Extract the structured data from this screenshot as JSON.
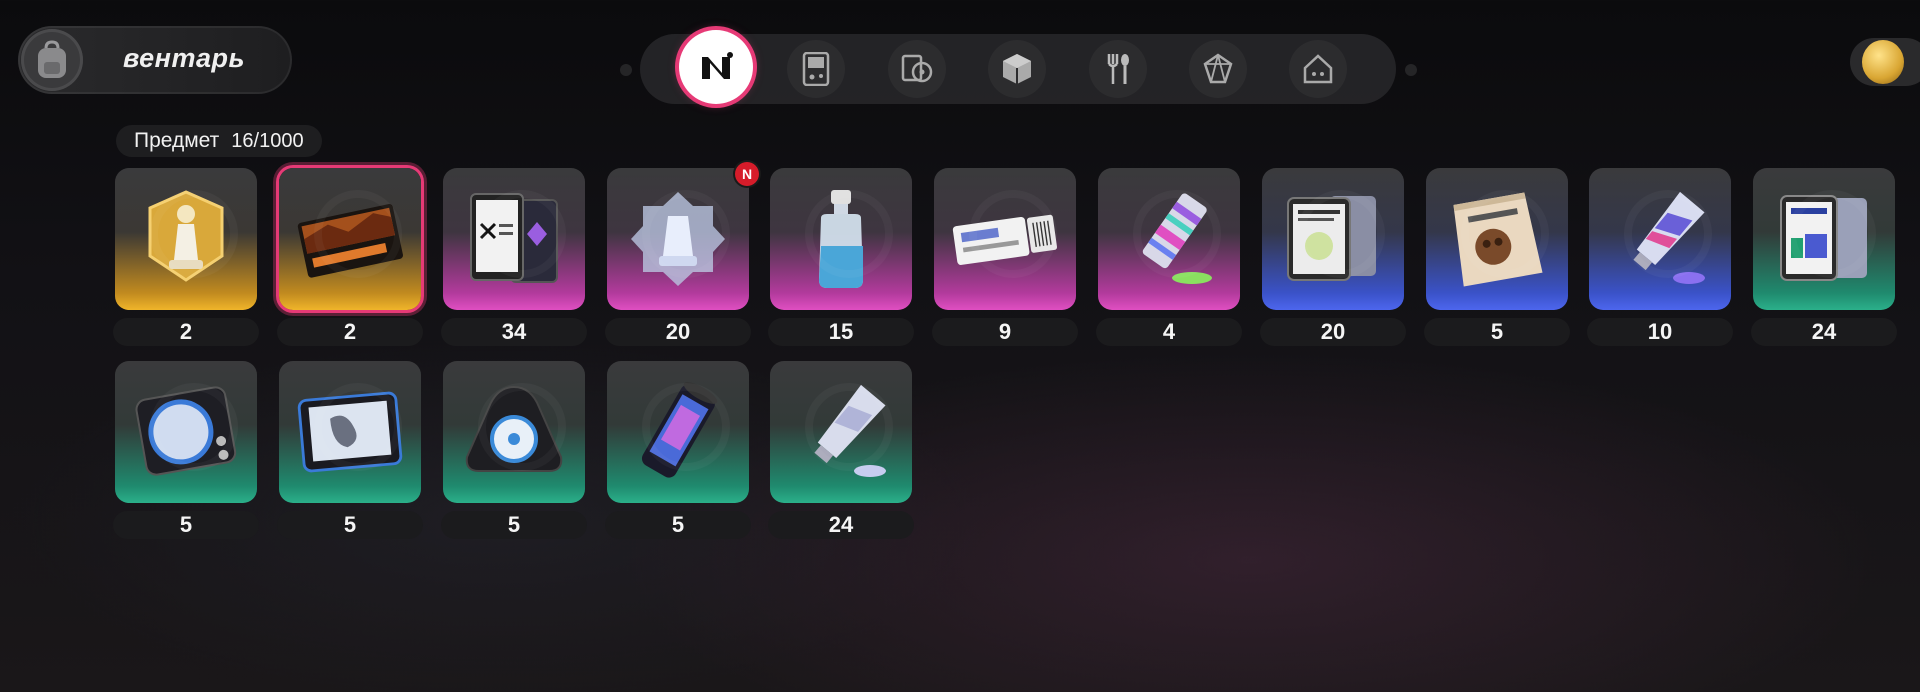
{
  "header": {
    "title": "вентарь",
    "bag_icon": "backpack-icon"
  },
  "nav": {
    "categories": [
      {
        "icon": "brand-n-icon",
        "active": true
      },
      {
        "icon": "gameboy-icon",
        "active": false
      },
      {
        "icon": "media-disc-icon",
        "active": false
      },
      {
        "icon": "cube-icon",
        "active": false
      },
      {
        "icon": "fork-spoon-icon",
        "active": false
      },
      {
        "icon": "crystal-icon",
        "active": false
      },
      {
        "icon": "home-gamepad-icon",
        "active": false
      }
    ]
  },
  "currency": {
    "icon": "golden-egg-icon"
  },
  "capacity": {
    "label": "Предмет",
    "value": "16/1000"
  },
  "items": [
    {
      "icon": "chess-trophy-icon",
      "rarity": "gold",
      "qty": "2",
      "selected": false,
      "new": false
    },
    {
      "icon": "ticket-card-icon",
      "rarity": "gold",
      "qty": "2",
      "selected": true,
      "new": false
    },
    {
      "icon": "phone-cards-icon",
      "rarity": "pink",
      "qty": "34",
      "selected": false,
      "new": false
    },
    {
      "icon": "crystal-trophy-icon",
      "rarity": "pink",
      "qty": "20",
      "selected": false,
      "new": true,
      "badge": "N"
    },
    {
      "icon": "bottle-icon",
      "rarity": "pink",
      "qty": "15",
      "selected": false,
      "new": false
    },
    {
      "icon": "ticket-icon",
      "rarity": "pink",
      "qty": "9",
      "selected": false,
      "new": false
    },
    {
      "icon": "glitch-tube-icon",
      "rarity": "pink",
      "qty": "4",
      "selected": false,
      "new": false
    },
    {
      "icon": "tablet-cards-icon",
      "rarity": "blue",
      "qty": "20",
      "selected": false,
      "new": false
    },
    {
      "icon": "snack-bag-icon",
      "rarity": "blue",
      "qty": "5",
      "selected": false,
      "new": false
    },
    {
      "icon": "paint-tube-icon",
      "rarity": "blue",
      "qty": "10",
      "selected": false,
      "new": false
    },
    {
      "icon": "phone-cards-icon",
      "rarity": "green",
      "qty": "24",
      "selected": false,
      "new": false
    },
    {
      "icon": "cassette-player-icon",
      "rarity": "green",
      "qty": "5",
      "selected": false,
      "new": false
    },
    {
      "icon": "screen-device-icon",
      "rarity": "green",
      "qty": "5",
      "selected": false,
      "new": false
    },
    {
      "icon": "spinner-device-icon",
      "rarity": "green",
      "qty": "5",
      "selected": false,
      "new": false
    },
    {
      "icon": "canister-icon",
      "rarity": "green",
      "qty": "5",
      "selected": false,
      "new": false
    },
    {
      "icon": "paint-tube-icon",
      "rarity": "green",
      "qty": "24",
      "selected": false,
      "new": false
    }
  ]
}
